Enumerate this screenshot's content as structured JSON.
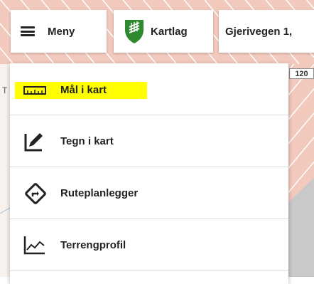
{
  "toolbar": {
    "menu_label": "Meny",
    "layers_label": "Kartlag",
    "address_label": "Gjerivegen 1,"
  },
  "map": {
    "road_number": "120",
    "edge_letter": "T",
    "background_color": "#f7f2ee",
    "zone_color": "#f2c9bd"
  },
  "menu": {
    "items": [
      {
        "label": "Mål i kart",
        "icon": "ruler-icon",
        "highlighted": true
      },
      {
        "label": "Tegn i kart",
        "icon": "draw-pencil-icon",
        "highlighted": false
      },
      {
        "label": "Ruteplanlegger",
        "icon": "route-sign-icon",
        "highlighted": false
      },
      {
        "label": "Terrengprofil",
        "icon": "terrain-profile-icon",
        "highlighted": false
      }
    ]
  },
  "colors": {
    "highlight": "#ffff00",
    "shield_green": "#2f8a2f"
  }
}
